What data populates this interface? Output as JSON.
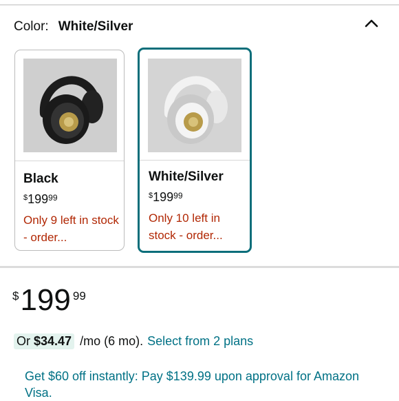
{
  "color_selector": {
    "label": "Color:",
    "selected": "White/Silver"
  },
  "variants": [
    {
      "name": "Black",
      "price_symbol": "$",
      "price_whole": "199",
      "price_cents": "99",
      "stock": "Only 9 left in stock - order...",
      "image": "black-headphones"
    },
    {
      "name": "White/Silver",
      "price_symbol": "$",
      "price_whole": "199",
      "price_cents": "99",
      "stock": "Only 10 left in stock - order...",
      "image": "silver-headphones"
    }
  ],
  "price": {
    "symbol": "$",
    "whole": "199",
    "cents": "99"
  },
  "installment": {
    "prefix": "Or",
    "amount": "$34.47",
    "term": "/mo (6 mo).",
    "link": "Select from 2 plans"
  },
  "promo": {
    "text": "Get $60 off instantly: Pay $139.99 upon approval for Amazon Visa."
  },
  "colors": {
    "selected_border": "#0b6e7a",
    "stock_text": "#b12704",
    "link": "#007185",
    "highlight_bg": "#e3f3ee"
  },
  "icons": {
    "collapse": "chevron-up-icon"
  }
}
